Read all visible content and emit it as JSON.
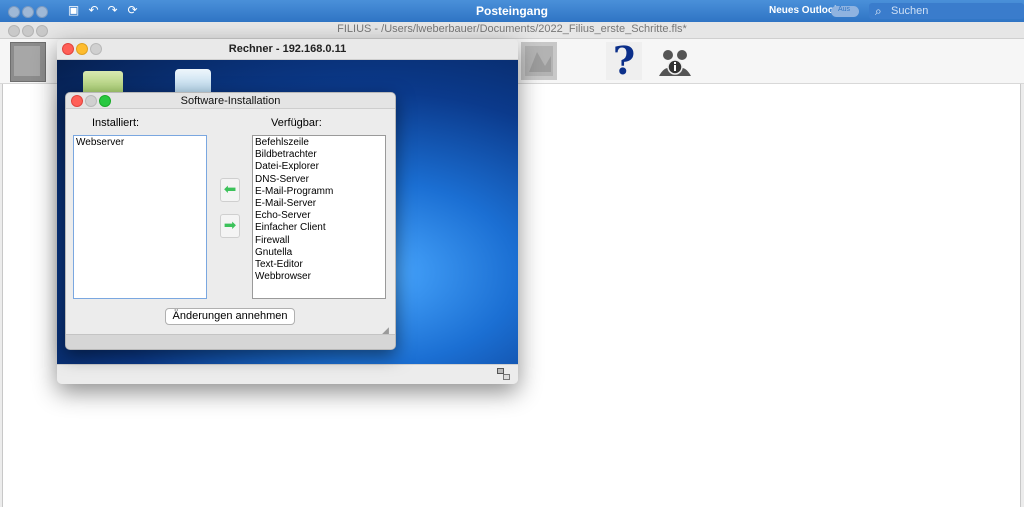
{
  "outlook": {
    "title": "Posteingang",
    "new_outlook_label": "Neues Outlook",
    "toggle_label": "Aus",
    "search_placeholder": "Suchen",
    "icons": [
      "save-icon",
      "undo-icon",
      "redo-icon",
      "sync-icon"
    ]
  },
  "filius": {
    "window_title": "FILIUS - /Users/lweberbauer/Documents/2022_Filius_erste_Schritte.fls*",
    "toolbar_icons": [
      "mode-icon",
      "image-icon",
      "help-icon",
      "info-icon"
    ]
  },
  "rechner": {
    "title": "Rechner - 192.168.0.11",
    "desktop_icons": [
      "software-installer-icon",
      "application-icon"
    ]
  },
  "dialog": {
    "title": "Software-Installation",
    "installed_label": "Installiert:",
    "available_label": "Verfügbar:",
    "installed": [
      "Webserver"
    ],
    "available": [
      "Befehlszeile",
      "Bildbetrachter",
      "Datei-Explorer",
      "DNS-Server",
      "E-Mail-Programm",
      "E-Mail-Server",
      "Echo-Server",
      "Einfacher Client",
      "Firewall",
      "Gnutella",
      "Text-Editor",
      "Webbrowser"
    ],
    "move_left_glyph": "⬅",
    "move_right_glyph": "➡",
    "apply_label": "Änderungen annehmen"
  },
  "colors": {
    "outlook_bar": "#2f74c4",
    "desktop_blue": "#1b6fd3",
    "arrow_green": "#3cc25a"
  }
}
